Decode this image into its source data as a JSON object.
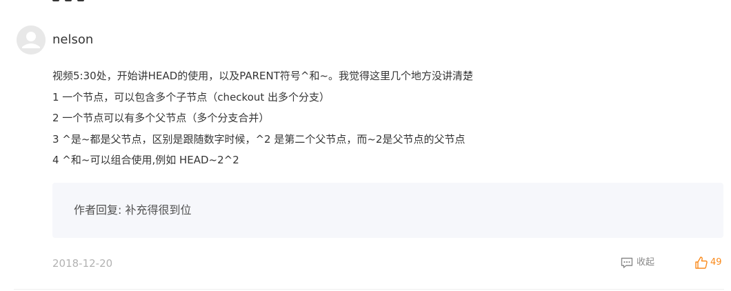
{
  "comment": {
    "author": "nelson",
    "lines": [
      "视频5:30处，开始讲HEAD的使用，以及PARENT符号^和~。我觉得这里几个地方没讲清楚",
      "1 一个节点，可以包含多个子节点（checkout 出多个分支）",
      "2 一个节点可以有多个父节点（多个分支合并）",
      "3 ^是~都是父节点，区别是跟随数字时候，^2 是第二个父节点，而~2是父节点的父节点",
      "4 ^和~可以组合使用,例如 HEAD~2^2"
    ],
    "reply": "作者回复: 补充得很到位",
    "date": "2018-12-20",
    "collapse_label": "收起",
    "like_count": "49"
  },
  "colors": {
    "text": "#353535",
    "muted": "#b2b2b2",
    "reply_bg": "#f6f7fb",
    "accent": "#fa8919"
  },
  "icons": {
    "avatar": "user-avatar-placeholder",
    "collapse": "comment-bubble-icon",
    "like": "thumbs-up-icon"
  }
}
